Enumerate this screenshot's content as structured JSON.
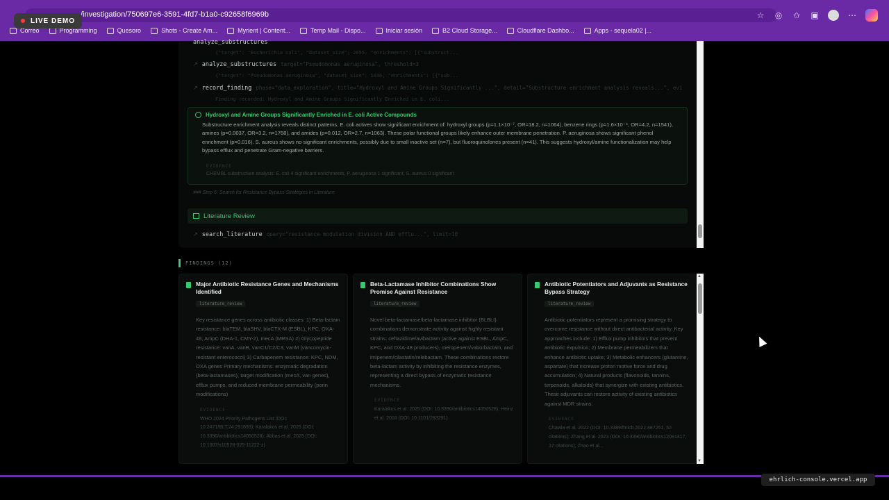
{
  "browser": {
    "url": "/investigation/750697e6-3591-4fd7-b1a0-c92658f6969b",
    "live_badge": "LIVE DEMO",
    "bookmarks": [
      "Correo",
      "Programming",
      "Quesoro",
      "Shots - Create Am...",
      "Myrient | Content...",
      "Temp Mail - Dispo...",
      "Iniciar sesión",
      "B2 Cloud Storage...",
      "Cloudflare Dashbo...",
      "Apps - sequela02 |..."
    ]
  },
  "log": {
    "tool1_name": "analyze_substructures",
    "tool1_sub": "{\"target\": \"Escherichia coli\", \"dataset_size\": 2055, \"enrichments\": [{\"substruct...",
    "tool2_name": "analyze_substructures",
    "tool2_args": "target=\"Pseudomonas aeruginosa\", threshold=3",
    "tool2_sub": "{\"target\": \"Pseudomonas aeruginosa\", \"dataset_size\": 1036, \"enrichments\": [{\"sub...",
    "tool3_name": "record_finding",
    "tool3_args": "phase=\"data_exploration\", title=\"Hydroxyl and Amine Groups Significantly ...\", detail=\"Substructure enrichment analysis reveals...\", evidence=\"CHEMBL...",
    "tool3_sub": "Finding recorded: Hydroxyl and Amine Groups Significantly Enriched in E. coli...",
    "finding_title": "Hydroxyl and Amine Groups Significantly Enriched in E. coli Active Compounds",
    "finding_body": "Substructure enrichment analysis reveals distinct patterns. E. coli actives show significant enrichment of: hydroxyl groups (p=1.1×10⁻⁷, OR=18.2, n=1064), benzene rings (p=1.6×10⁻⁴, OR=4.2, n=1541), amines (p=0.0037, OR=3.2, n=1768), and amides (p=0.012, OR=2.7, n=1063). These polar functional groups likely enhance outer membrane penetration. P. aeruginosa shows significant phenol enrichment (p=0.016). S. aureus shows no significant enrichments, possibly due to small inactive set (n=7), but fluoroquinolones present (n=41). This suggests hydroxyl/amine functionalization may help bypass efflux and penetrate Gram-negative barriers.",
    "finding_ev_label": "EVIDENCE",
    "finding_ev": "CHEMBL substructure analysis: E. coli 4 significant enrichments, P. aeruginosa 1 significant, S. aureus 0 significant",
    "step": "### Step 6: Search for Resistance Bypass Strategies in Literature",
    "section": "Literature Review",
    "tool4_name": "search_literature",
    "tool4_args": "query=\"resistance modulation division AND efflu...\", limit=10"
  },
  "findings": {
    "label": "FINDINGS (12)",
    "cards": [
      {
        "title": "Major Antibiotic Resistance Genes and Mechanisms Identified",
        "tag": "literature_review",
        "desc": "Key resistance genes across antibiotic classes: 1) Beta-lactam resistance: blaTEM, blaSHV, blaCTX-M (ESBL), KPC, OXA-48, AmpC (DHA-1, CMY-2), mecA (MRSA) 2) Glycopeptide resistance: vanA, vanB, vanC1/C2/C3, vanM (vancomycin-resistant enterococci) 3) Carbapenem resistance: KPC, NDM, OXA genes Primary mechanisms: enzymatic degradation (beta-lactamases), target modification (mecA, van genes), efflux pumps, and reduced membrane permeability (porin modifications)",
        "ev_label": "EVIDENCE",
        "ev": "WHO 2024 Priority Pathogens List (DOI: 10.2471/BLT.24.291693); Karalakos et al. 2025 (DOI: 10.3390/antibiotics14050528); Abbas et al. 2025 (DOI: 10.1007/s10528-025-11222-z)"
      },
      {
        "title": "Beta-Lactamase Inhibitor Combinations Show Promise Against Resistance",
        "tag": "literature_review",
        "desc": "Novel beta-lactamase/beta-lactamase inhibitor (BLBLI) combinations demonstrate activity against highly resistant strains: ceftazidime/avibactam (active against ESBL, AmpC, KPC, and OXA-48 producers), meropenem/vaborbactam, and imipenem/cilastatin/relebactam. These combinations restore beta-lactam activity by inhibiting the resistance enzymes, representing a direct bypass of enzymatic resistance mechanisms.",
        "ev_label": "EVIDENCE",
        "ev": "Karalakos et al. 2025 (DOI: 10.3390/antibiotics14050528); Heinz et al. 2018 (DOI: 10.1101/283291)"
      },
      {
        "title": "Antibiotic Potentiators and Adjuvants as Resistance Bypass Strategy",
        "tag": "literature_review",
        "desc": "Antibiotic potentiators represent a promising strategy to overcome resistance without direct antibacterial activity. Key approaches include: 1) Efflux pump inhibitors that prevent antibiotic expulsion; 2) Membrane permeabilizers that enhance antibiotic uptake; 3) Metabolic enhancers (glutamine, aspartate) that increase proton motive force and drug accumulation; 4) Natural products (flavonoids, tannins, terpenoids, alkaloids) that synergize with existing antibiotics. These adjuvants can restore activity of existing antibiotics against MDR strains.",
        "ev_label": "EVIDENCE",
        "ev": "Chawla et al. 2022 (DOI: 10.3389/fmicb.2022.887251, 52 citations); Zhang et al. 2023 (DOI: 10.3390/antibiotics12091417, 37 citations); Zhao et al..."
      }
    ]
  },
  "footer": {
    "host": "ehrlich-console.vercel.app"
  },
  "colors": {
    "accent": "#35c971",
    "chrome": "#6a2aa6",
    "background": "#000000"
  }
}
